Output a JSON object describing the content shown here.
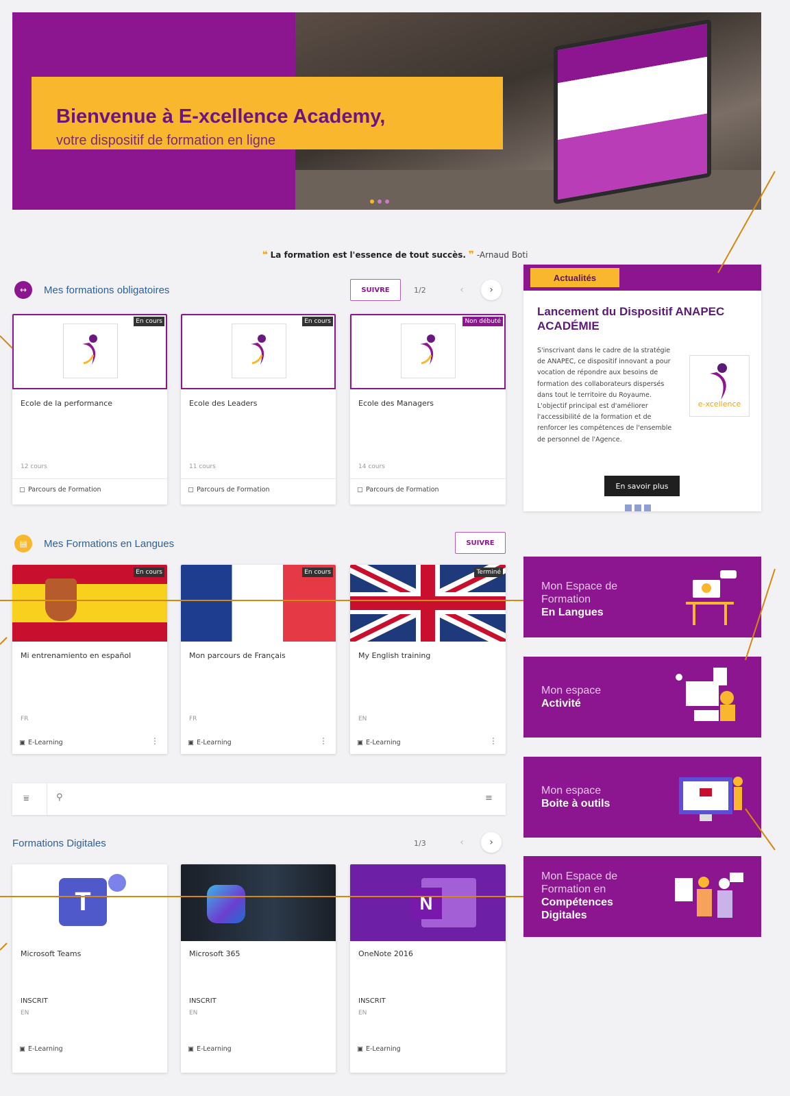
{
  "banner": {
    "title": "Bienvenue à E-xcellence Academy,",
    "subtitle": "votre dispositif de formation en ligne"
  },
  "quote": {
    "text": "La formation est l'essence de tout succès.",
    "author": "-Arnaud Boti"
  },
  "mandatory": {
    "title": "Mes formations obligatoires",
    "follow": "SUIVRE",
    "pager": "1/2",
    "cards": [
      {
        "badge": "En cours",
        "title": "Ecole de la performance",
        "meta": "12 cours",
        "type": "Parcours de Formation"
      },
      {
        "badge": "En cours",
        "title": "Ecole des Leaders",
        "meta": "11 cours",
        "type": "Parcours de Formation"
      },
      {
        "badge": "Non débuté",
        "title": "Ecole des Managers",
        "meta": "14 cours",
        "type": "Parcours de Formation"
      }
    ]
  },
  "languages": {
    "title": "Mes Formations en Langues",
    "follow": "SUIVRE",
    "cards": [
      {
        "badge": "En cours",
        "title": "Mi entrenamiento en español",
        "meta": "FR",
        "type": "E-Learning"
      },
      {
        "badge": "En cours",
        "title": "Mon parcours de Français",
        "meta": "FR",
        "type": "E-Learning"
      },
      {
        "badge": "Terminé",
        "title": "My English training",
        "meta": "EN",
        "type": "E-Learning"
      }
    ]
  },
  "digital": {
    "title": "Formations Digitales",
    "pager": "1/3",
    "cards": [
      {
        "title": "Microsoft Teams",
        "status": "INSCRIT",
        "meta": "EN",
        "type": "E-Learning"
      },
      {
        "title": "Microsoft 365",
        "status": "INSCRIT",
        "meta": "EN",
        "type": "E-Learning"
      },
      {
        "title": "OneNote 2016",
        "status": "INSCRIT",
        "meta": "EN",
        "type": "E-Learning"
      }
    ]
  },
  "news": {
    "tag": "Actualités",
    "title": "Lancement du Dispositif ANAPEC ACADÉMIE",
    "body": "S'inscrivant dans le cadre de la stratégie de ANAPEC, ce dispositif innovant a pour vocation de répondre aux besoins de formation des collaborateurs dispersés dans tout le territoire du Royaume. L'objectif principal est d'améliorer l'accessibilité de la formation et de renforcer les compétences de l'ensemble de personnel de l'Agence.",
    "more": "En savoir plus",
    "logo_text": "e-xcellence"
  },
  "tiles": [
    {
      "line1": "Mon Espace de",
      "line2": "Formation",
      "bold": "En Langues"
    },
    {
      "line1": "Mon espace",
      "bold": "Activité"
    },
    {
      "line1": "Mon espace",
      "bold": "Boite à outils"
    },
    {
      "line1": "Mon Espace de",
      "line2": "Formation en",
      "bold": "Compétences",
      "bold2": "Digitales"
    }
  ],
  "colors": {
    "purple": "#8c1590",
    "yellow": "#f8b72c",
    "orange_line": "#d4880e"
  }
}
